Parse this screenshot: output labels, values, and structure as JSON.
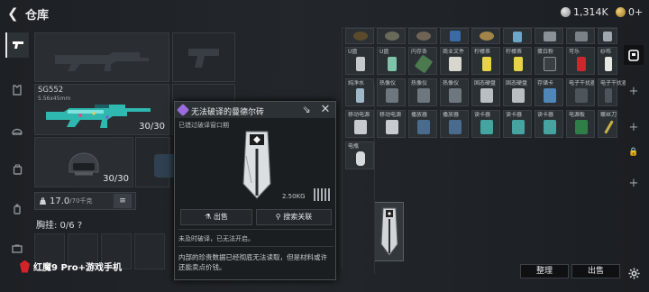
{
  "header": {
    "title": "仓库",
    "currency_1": "1,314K",
    "currency_2": "0+"
  },
  "nav": [
    "pistol-icon",
    "vest-icon",
    "helmet-icon",
    "backpack-icon",
    "grenade-icon",
    "box-icon"
  ],
  "weapon": {
    "name": "SG552",
    "ammo": "5.56x45mm",
    "count": "30/30"
  },
  "helmet": {
    "count": "30/30"
  },
  "weight": {
    "value": "17.0",
    "max": "/70千克"
  },
  "chest": {
    "label": "胸挂: 0/6 ?"
  },
  "brand": "红魔9 Pro+游戏手机",
  "grid": {
    "rows": [
      [
        "",
        "",
        "",
        "",
        "",
        "",
        "",
        ""
      ],
      [
        "U盘",
        "U盘",
        "内存条",
        "商业文件",
        "柠檬茶",
        "柠檬茶",
        "蛋白粉",
        "可乐"
      ],
      [
        "纯净水",
        "热像仪",
        "热像仪",
        "热像仪",
        "固态硬盘",
        "固态硬盘",
        "存储卡",
        "电子干扰器"
      ],
      [
        "移动电源",
        "移动电源",
        "播放器",
        "播放器",
        "读卡器",
        "读卡器",
        "读卡器",
        "电源板"
      ],
      [
        "电瓶"
      ]
    ],
    "extra": [
      "纱布",
      "电子干扰器",
      "螺丝刀"
    ]
  },
  "buttons": {
    "sort": "整理",
    "sell": "出售"
  },
  "popup": {
    "title": "无法破译的曼德尔砖",
    "expired": "已错过破译窗口期",
    "weight": "2.50KG",
    "sell": "出售",
    "search": "搜索关联",
    "note": "未及时破译，已无法开启。",
    "desc": "内部的珍贵数据已经彻底无法读取，但是材料或许还能卖点价钱。"
  }
}
